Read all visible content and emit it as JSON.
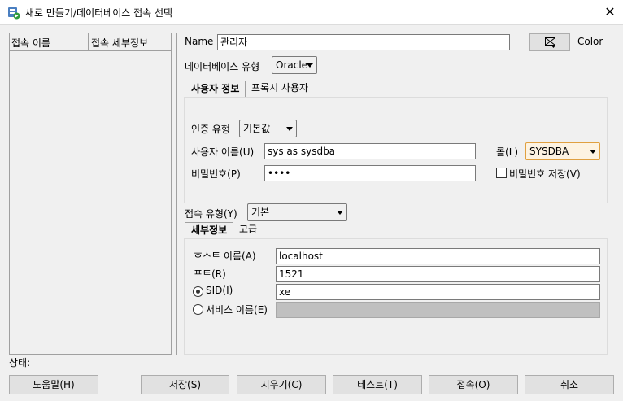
{
  "window": {
    "title": "새로 만들기/데이터베이스 접속 선택",
    "close": "✕"
  },
  "list": {
    "col1": "접속 이름",
    "col2": "접속 세부정보"
  },
  "form": {
    "name_label": "Name",
    "name_value": "관리자",
    "color_label": "Color",
    "dbtype_label": "데이터베이스 유형",
    "dbtype_value": "Oracle"
  },
  "tabs_top": [
    "사용자 정보",
    "프록시 사용자"
  ],
  "user_info": {
    "auth_label": "인증 유형",
    "auth_value": "기본값",
    "username_label": "사용자 이름(U)",
    "username_value": "sys as sysdba",
    "role_label": "롤(L)",
    "role_value": "SYSDBA",
    "password_label": "비밀번호(P)",
    "password_value": "••••",
    "save_password_label": "비밀번호 저장(V)",
    "save_password_checked": false
  },
  "conn_type": {
    "label": "접속 유형(Y)",
    "value": "기본"
  },
  "tabs_bottom": [
    "세부정보",
    "고급"
  ],
  "details": {
    "host_label": "호스트 이름(A)",
    "host_value": "localhost",
    "port_label": "포트(R)",
    "port_value": "1521",
    "sid_label": "SID(I)",
    "sid_value": "xe",
    "service_label": "서비스 이름(E)",
    "service_value": ""
  },
  "status_label": "상태:",
  "buttons": {
    "help": "도움말(H)",
    "save": "저장(S)",
    "clear": "지우기(C)",
    "test": "테스트(T)",
    "connect": "접속(O)",
    "cancel": "취소"
  },
  "colors": {
    "role_highlight": "#e0a040",
    "disabled_field": "#c0c0c0"
  }
}
